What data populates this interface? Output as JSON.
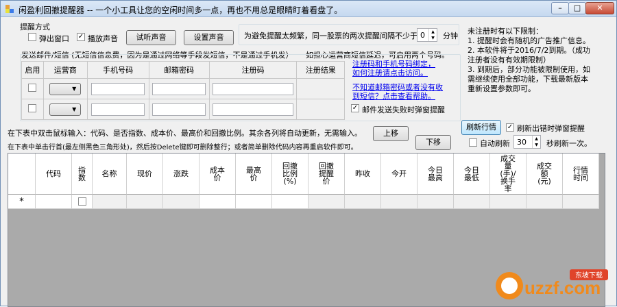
{
  "window": {
    "title": "闲盈利回撤提醒器 -- 一个小工具让您的空闲时间多一点，再也不用总是眼睛盯着看盘了。",
    "controls": [
      "minimize",
      "maximize",
      "close"
    ]
  },
  "alert": {
    "group_title": "提醒方式",
    "popup_label": "弹出窗口",
    "popup_checked": false,
    "sound_label": "播放声音",
    "sound_checked": true,
    "try_sound_label": "试听声音",
    "set_sound_label": "设置声音"
  },
  "interval": {
    "prefix": "为避免提醒太频繁，同一股票的两次提醒间隔不少于",
    "value": "0",
    "suffix": "分钟"
  },
  "email": {
    "group_title": "发送邮件/短信 (无短信信息费，因为是通过网络等手段发短信，不是通过手机发）",
    "note": "如担心运营商短信延迟，可启用两个号码。",
    "headers": [
      "启用",
      "运营商",
      "手机号码",
      "邮箱密码",
      "注册码",
      "注册结果"
    ],
    "rows": [
      {
        "enabled": false,
        "carrier": "",
        "phone": "",
        "password": "",
        "reg_code": "",
        "result": ""
      },
      {
        "enabled": false,
        "carrier": "",
        "phone": "",
        "password": "",
        "reg_code": "",
        "result": ""
      }
    ],
    "link1_line1": "注册码和手机号码绑定，",
    "link1_line2": "如何注册请点击访问。",
    "link2_line1": "不知道邮箱密码或者没有收",
    "link2_line2": "到短信？点击查看帮助。",
    "fail_popup_label": "邮件发送失败时弹窗提醒",
    "fail_popup_checked": true
  },
  "unregistered": {
    "title": "未注册时有以下限制：",
    "lines": [
      "1. 提醒时会有随机的广告推广信息。",
      "2. 本软件将于2016/7/2到期。（成功",
      "注册者没有有效期限制）",
      "3. 到期后，部分功能被限制使用，如",
      "需继续使用全部功能，下载最新版本",
      "重新设置参数即可。"
    ]
  },
  "instructions": {
    "line1": "在下表中双击鼠标输入：代码、是否指数、成本价、最高价和回撤比例。其余各列将自动更新，无需输入。",
    "line2": "在下表中单击行首(最左侧黑色三角形处)，然后按Delete键即可删除整行；或者简单删除代码内容再重启软件即可。",
    "up_label": "上移",
    "down_label": "下移"
  },
  "refresh": {
    "refresh_label": "刷新行情",
    "popup_on_error_label": "刷新出错时弹窗提醒",
    "popup_on_error_checked": true,
    "auto_label": "自动刷新",
    "auto_checked": false,
    "seconds": "30",
    "seconds_suffix": "秒刷新一次。"
  },
  "grid": {
    "columns": [
      {
        "label": "代码"
      },
      {
        "label": "指数"
      },
      {
        "label": "名称"
      },
      {
        "label": "现价"
      },
      {
        "label": "涨跌"
      },
      {
        "label": "成本价"
      },
      {
        "label": "最高价"
      },
      {
        "label": "回撤比例(%)"
      },
      {
        "label": "回撤提醒价"
      },
      {
        "label": "昨收"
      },
      {
        "label": "今开"
      },
      {
        "label": "今日最高"
      },
      {
        "label": "今日最低"
      },
      {
        "label": "成交量(手)/换手率"
      },
      {
        "label": "成交额(元)"
      },
      {
        "label": "行情时间"
      }
    ],
    "new_row_marker": "*"
  },
  "watermark": {
    "text": "uzzf.com",
    "badge": "东坡下载"
  },
  "colors": {
    "link": "#0000ee",
    "grid_bg": "#aaaaaa",
    "titlebar": "#c5d8ef"
  }
}
